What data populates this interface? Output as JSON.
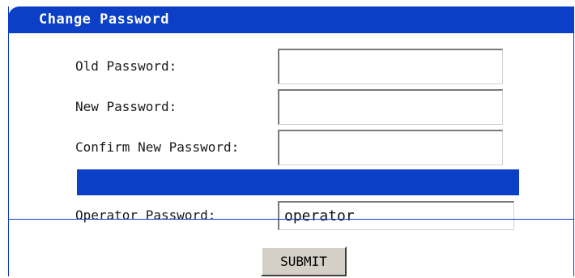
{
  "form": {
    "title": "Change Password",
    "old_password_label": "Old Password:",
    "new_password_label": "New Password:",
    "confirm_password_label": "Confirm New Password:",
    "operator_password_label": "Operator Password:",
    "old_password_value": "",
    "new_password_value": "",
    "confirm_password_value": "",
    "operator_password_value": "operator",
    "submit_label": "SUBMIT"
  },
  "colors": {
    "accent": "#0b3fc6",
    "button_face": "#d4d0c8"
  }
}
